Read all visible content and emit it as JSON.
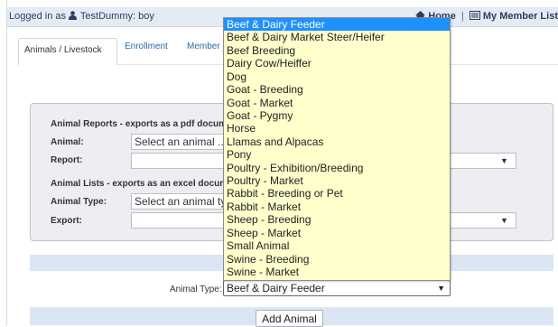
{
  "header": {
    "logged_in_prefix": "Logged in as",
    "user_icon": "user-icon",
    "username": "TestDummy: boy",
    "home_icon": "home-icon",
    "home_label": "Home",
    "separator": "|",
    "list_icon": "list-icon",
    "member_list_label": "My Member List"
  },
  "tabs": [
    {
      "label": "Animals / Livestock",
      "active": true
    },
    {
      "label": "Enrollment",
      "active": false
    },
    {
      "label": "Member",
      "active": false
    }
  ],
  "reports": {
    "reports_heading": "Animal Reports - exports as a pdf document",
    "animal_label": "Animal:",
    "animal_value": "Select an animal ...",
    "report_label": "Report:",
    "report_value": "",
    "lists_heading": "Animal Lists - exports as an excel document",
    "animal_type_label": "Animal Type:",
    "animal_type_value": "Select an animal type",
    "export_label": "Export:",
    "export_value": ""
  },
  "add": {
    "animal_type_label": "Animal Type:",
    "selected_value": "Beef & Dairy Feeder",
    "add_button_label": "Add Animal"
  },
  "dropdown": {
    "highlighted_index": 0,
    "highlight_color": "#1e90ff",
    "background_color": "#ffffcc",
    "options": [
      "Beef & Dairy Feeder",
      "Beef & Dairy Market Steer/Heifer",
      "Beef Breeding",
      "Dairy Cow/Heiffer",
      "Dog",
      "Goat - Breeding",
      "Goat - Market",
      "Goat - Pygmy",
      "Horse",
      "Llamas and Alpacas",
      "Pony",
      "Poultry - Exhibition/Breeding",
      "Poultry - Market",
      "Rabbit - Breeding or Pet",
      "Rabbit - Market",
      "Sheep - Breeding",
      "Sheep - Market",
      "Small Animal",
      "Swine - Breeding",
      "Swine - Market"
    ]
  }
}
